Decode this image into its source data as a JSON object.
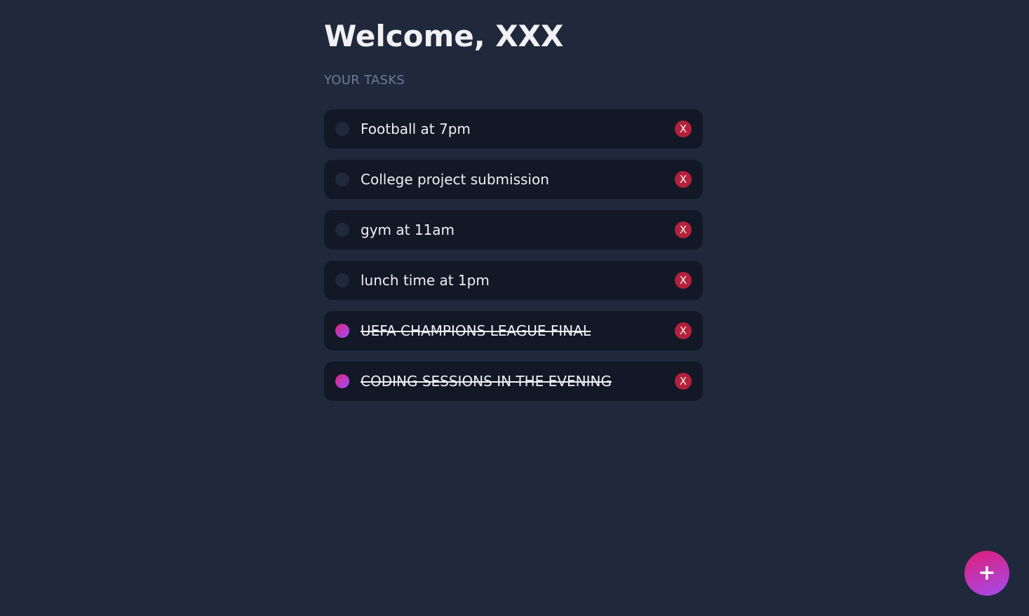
{
  "header": {
    "title": "Welcome, XXX",
    "section_label": "YOUR TASKS"
  },
  "tasks": [
    {
      "label": "Football at 7pm",
      "done": false,
      "delete_label": "X"
    },
    {
      "label": "College project submission",
      "done": false,
      "delete_label": "X"
    },
    {
      "label": "gym at 11am",
      "done": false,
      "delete_label": "X"
    },
    {
      "label": "lunch time at 1pm",
      "done": false,
      "delete_label": "X"
    },
    {
      "label": "UEFA CHAMPIONS LEAGUE FINAL",
      "done": true,
      "delete_label": "X"
    },
    {
      "label": "CODING SESSIONS IN THE EVENING",
      "done": true,
      "delete_label": "X"
    }
  ],
  "fab": {
    "label": "+",
    "icon": "plus-icon"
  },
  "colors": {
    "background": "#1f293b",
    "task_background": "#131826",
    "delete_button": "#b3213a",
    "accent_gradient_start": "#e0247b",
    "accent_gradient_end": "#9b4dff"
  }
}
